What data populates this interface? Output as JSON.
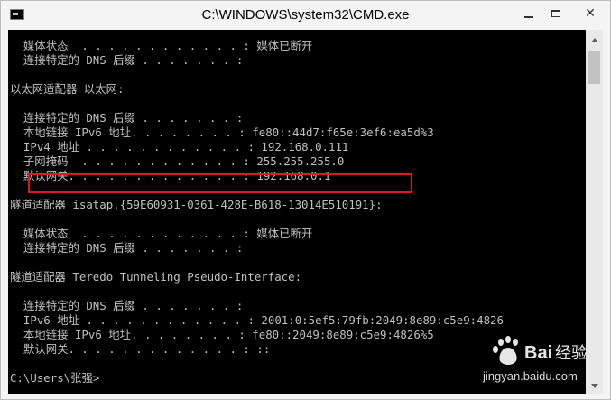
{
  "window": {
    "title": "C:\\WINDOWS\\system32\\CMD.exe",
    "controls": [
      "minimize",
      "maximize",
      "close"
    ],
    "close_glyph": "✕"
  },
  "console": {
    "lines": [
      "  媒体状态  . . . . . . . . . . . . : 媒体已断开",
      "  连接特定的 DNS 后缀 . . . . . . . :",
      "",
      "以太网适配器 以太网:",
      "",
      "  连接特定的 DNS 后缀 . . . . . . . :",
      "  本地链接 IPv6 地址. . . . . . . . : fe80::44d7:f65e:3ef6:ea5d%3",
      "  IPv4 地址 . . . . . . . . . . . . : 192.168.0.111",
      "  子网掩码  . . . . . . . . . . . . : 255.255.255.0",
      "  默认网关. . . . . . . . . . . . . : 192.168.0.1",
      "",
      "隧道适配器 isatap.{59E60931-0361-428E-B618-13014E510191}:",
      "",
      "  媒体状态  . . . . . . . . . . . . : 媒体已断开",
      "  连接特定的 DNS 后缀 . . . . . . . :",
      "",
      "隧道适配器 Teredo Tunneling Pseudo-Interface:",
      "",
      "  连接特定的 DNS 后缀 . . . . . . . :",
      "  IPv6 地址 . . . . . . . . . . . . : 2001:0:5ef5:79fb:2049:8e89:c5e9:4826",
      "  本地链接 IPv6 地址. . . . . . . . : fe80::2049:8e89:c5e9:4826%5",
      "  默认网关. . . . . . . . . . . . . : ::",
      "",
      "C:\\Users\\张强>"
    ],
    "text_color": "#c0c0c0",
    "background": "#000000"
  },
  "annotation": {
    "color": "#e0191f"
  },
  "watermark": {
    "text": "Baidu经验",
    "url": "jingyan.baidu.com"
  }
}
